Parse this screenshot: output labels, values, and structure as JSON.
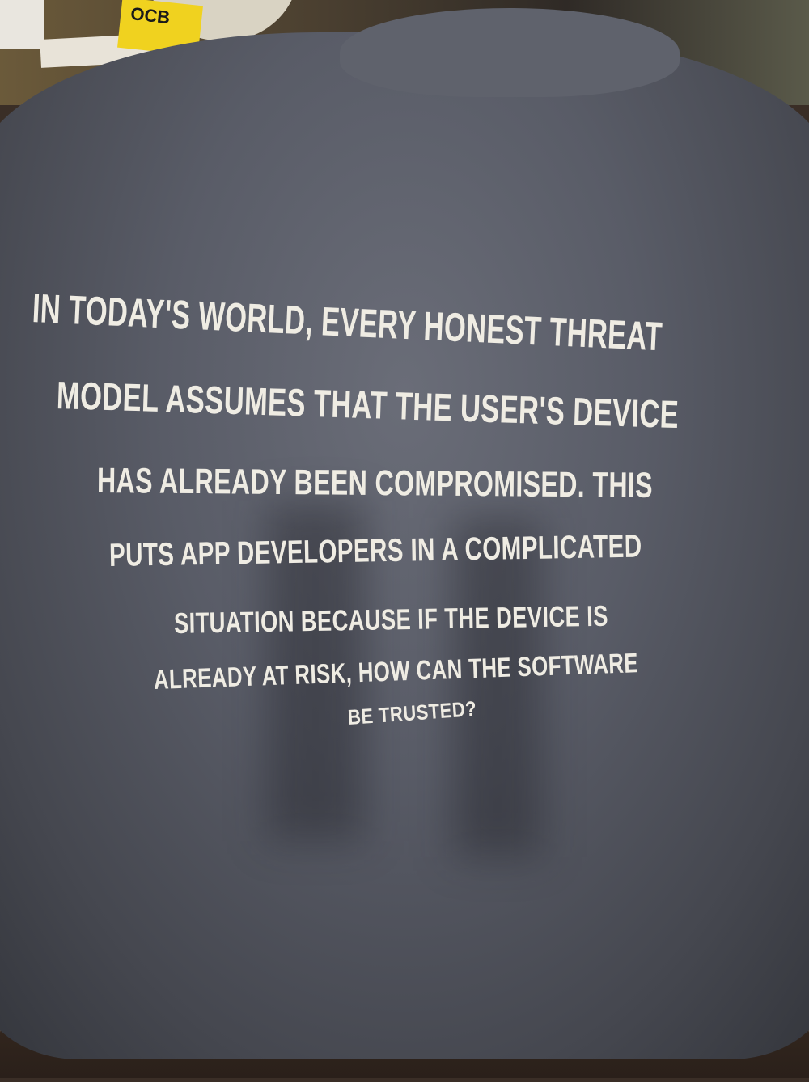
{
  "background_object": {
    "label": "OCB"
  },
  "print_text": [
    "IN TODAY'S WORLD, EVERY HONEST THREAT",
    "MODEL ASSUMES THAT THE USER'S DEVICE",
    "HAS ALREADY BEEN COMPROMISED. THIS",
    "PUTS APP DEVELOPERS IN A COMPLICATED",
    "SITUATION BECAUSE IF THE DEVICE IS",
    "ALREADY AT RISK, HOW CAN THE SOFTWARE",
    "BE TRUSTED?"
  ]
}
